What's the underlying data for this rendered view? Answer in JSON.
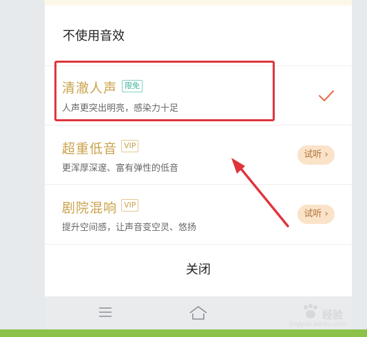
{
  "sheet": {
    "title": "不使用音效",
    "close_label": "关闭"
  },
  "options": [
    {
      "name": "清澈人声",
      "badge": "限免",
      "description": "人声更突出明亮，感染力十足",
      "selected": true
    },
    {
      "name": "超重低音",
      "badge": "VIP",
      "description": "更浑厚深邃、富有弹性的低音",
      "action_label": "试听 ›"
    },
    {
      "name": "剧院混响",
      "badge": "VIP",
      "description": "提升空间感，让声音变空灵、悠扬",
      "action_label": "试听 ›"
    }
  ],
  "navbar": {
    "icons": [
      "menu-icon",
      "home-icon"
    ]
  },
  "watermark": {
    "text": "经验",
    "sub": "jingyan.baidu.com"
  },
  "colors": {
    "gold": "#c9a24a",
    "highlight_red": "#e0343c",
    "check": "#e8714f",
    "free_badge": "#3db39a"
  }
}
